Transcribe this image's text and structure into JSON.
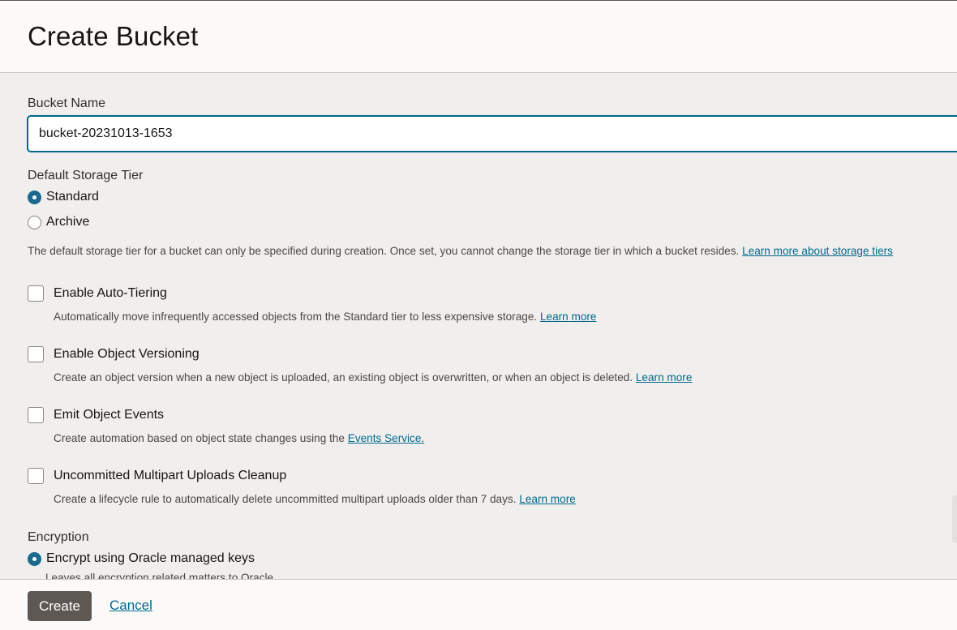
{
  "header": {
    "title": "Create Bucket"
  },
  "bucket_name": {
    "label": "Bucket Name",
    "value": "bucket-20231013-1653"
  },
  "storage_tier": {
    "label": "Default Storage Tier",
    "options": [
      {
        "label": "Standard",
        "selected": true
      },
      {
        "label": "Archive",
        "selected": false
      }
    ],
    "help": "The default storage tier for a bucket can only be specified during creation. Once set, you cannot change the storage tier in which a bucket resides.",
    "help_link": "Learn more about storage tiers"
  },
  "options": [
    {
      "label": "Enable Auto-Tiering",
      "help": "Automatically move infrequently accessed objects from the Standard tier to less expensive storage.",
      "link": "Learn more"
    },
    {
      "label": "Enable Object Versioning",
      "help": "Create an object version when a new object is uploaded, an existing object is overwritten, or when an object is deleted.",
      "link": "Learn more"
    },
    {
      "label": "Emit Object Events",
      "help": "Create automation based on object state changes using the",
      "link": "Events Service."
    },
    {
      "label": "Uncommitted Multipart Uploads Cleanup",
      "help": "Create a lifecycle rule to automatically delete uncommitted multipart uploads older than 7 days.",
      "link": "Learn more"
    }
  ],
  "encryption": {
    "label": "Encryption",
    "option_label": "Encrypt using Oracle managed keys",
    "option_help": "Leaves all encryption related matters to Oracle."
  },
  "footer": {
    "create_label": "Create",
    "cancel_label": "Cancel"
  },
  "colors": {
    "accent": "#00688c",
    "radio_checked": "#1a6a8f",
    "primary_button": "#5e5854"
  }
}
